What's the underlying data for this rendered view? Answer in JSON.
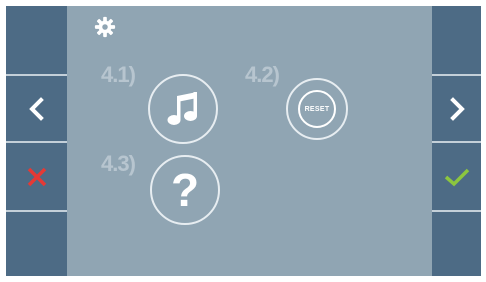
{
  "menu": {
    "items": [
      {
        "number": "4.1)",
        "icon": "music-note-icon"
      },
      {
        "number": "4.2)",
        "icon": "reset-icon",
        "label": "RESET"
      },
      {
        "number": "4.3)",
        "icon": "question-mark-icon",
        "label": "?"
      }
    ]
  },
  "nav": {
    "left": {
      "icon": "chevron-left-icon"
    },
    "right": {
      "icon": "chevron-right-icon"
    },
    "cancel": {
      "icon": "close-icon",
      "color": "#e53935"
    },
    "confirm": {
      "icon": "check-icon",
      "color": "#8cc63f"
    }
  },
  "colors": {
    "panel": "#90a5b3",
    "sidebar": "#4d6b85",
    "numbers": "#b7c5cf",
    "ring": "#e7edf1"
  },
  "header": {
    "icon": "gear-icon"
  }
}
